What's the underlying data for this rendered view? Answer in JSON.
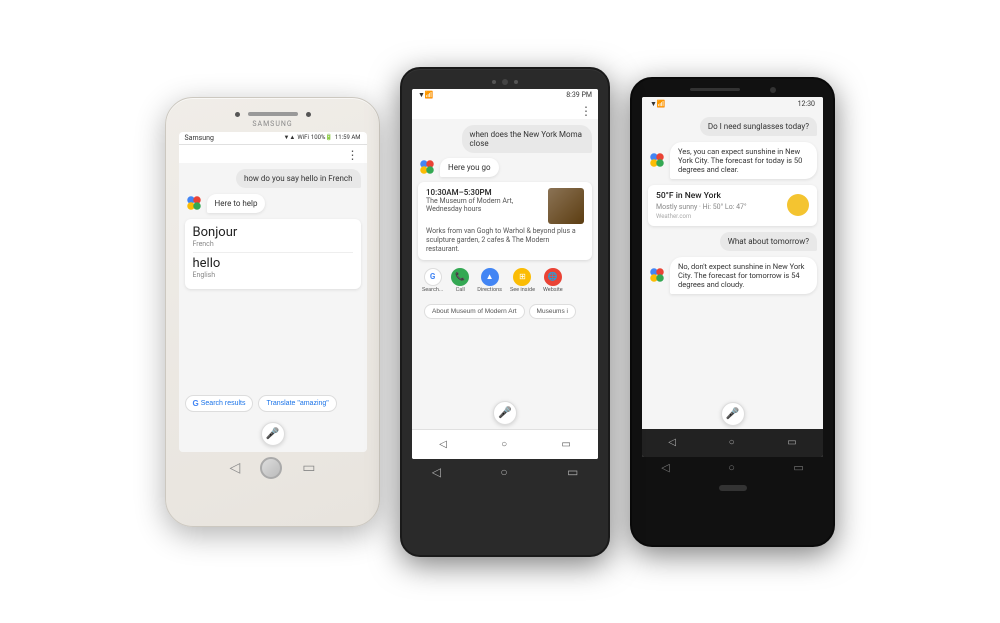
{
  "phone1": {
    "brand": "SAMSUNG",
    "status": {
      "carrier": "Samsung",
      "time": "11:59 AM",
      "battery": "100%",
      "signal": "▼▲ 100%🔋"
    },
    "chat": {
      "user_bubble": "how do you say hello in French",
      "assistant_bubble": "Here to help",
      "translation_word1": "Bonjour",
      "translation_lang1": "French",
      "translation_word2": "hello",
      "translation_lang2": "English",
      "btn_search": "Search results",
      "btn_translate": "Translate \"amazing\""
    }
  },
  "phone2": {
    "status": {
      "time": "8:39 PM",
      "icons": "▼ 📶"
    },
    "chat": {
      "user_bubble": "when does the New York Moma close",
      "assistant_bubble": "Here you go",
      "card_hours": "10:30AM–5:30PM",
      "card_sub": "The Museum of Modern Art, Wednesday hours",
      "card_desc": "Works from van Gogh to Warhol & beyond plus a sculpture garden, 2 cafes & The Modern restaurant.",
      "btn_about": "About Museum of Modern Art",
      "btn_museums": "Museums i",
      "action_search": "Search...",
      "action_call": "Call",
      "action_directions": "Directions",
      "action_inside": "See inside",
      "action_website": "Website"
    }
  },
  "phone3": {
    "status": {
      "time": "12:30",
      "icons": "▼ 📶🔋"
    },
    "chat": {
      "user_bubble1": "Do I need sunglasses today?",
      "assistant_bubble1": "Yes, you can expect sunshine in New York City. The forecast for today is 50 degrees and clear.",
      "weather_title": "50°F in New York",
      "weather_sub": "Mostly sunny · Hi: 50° Lo: 47°",
      "weather_source": "Weather.com",
      "user_bubble2": "What about tomorrow?",
      "assistant_bubble2": "No, don't expect sunshine in New York City. The forecast for tomorrow is 54 degrees and cloudy."
    }
  }
}
